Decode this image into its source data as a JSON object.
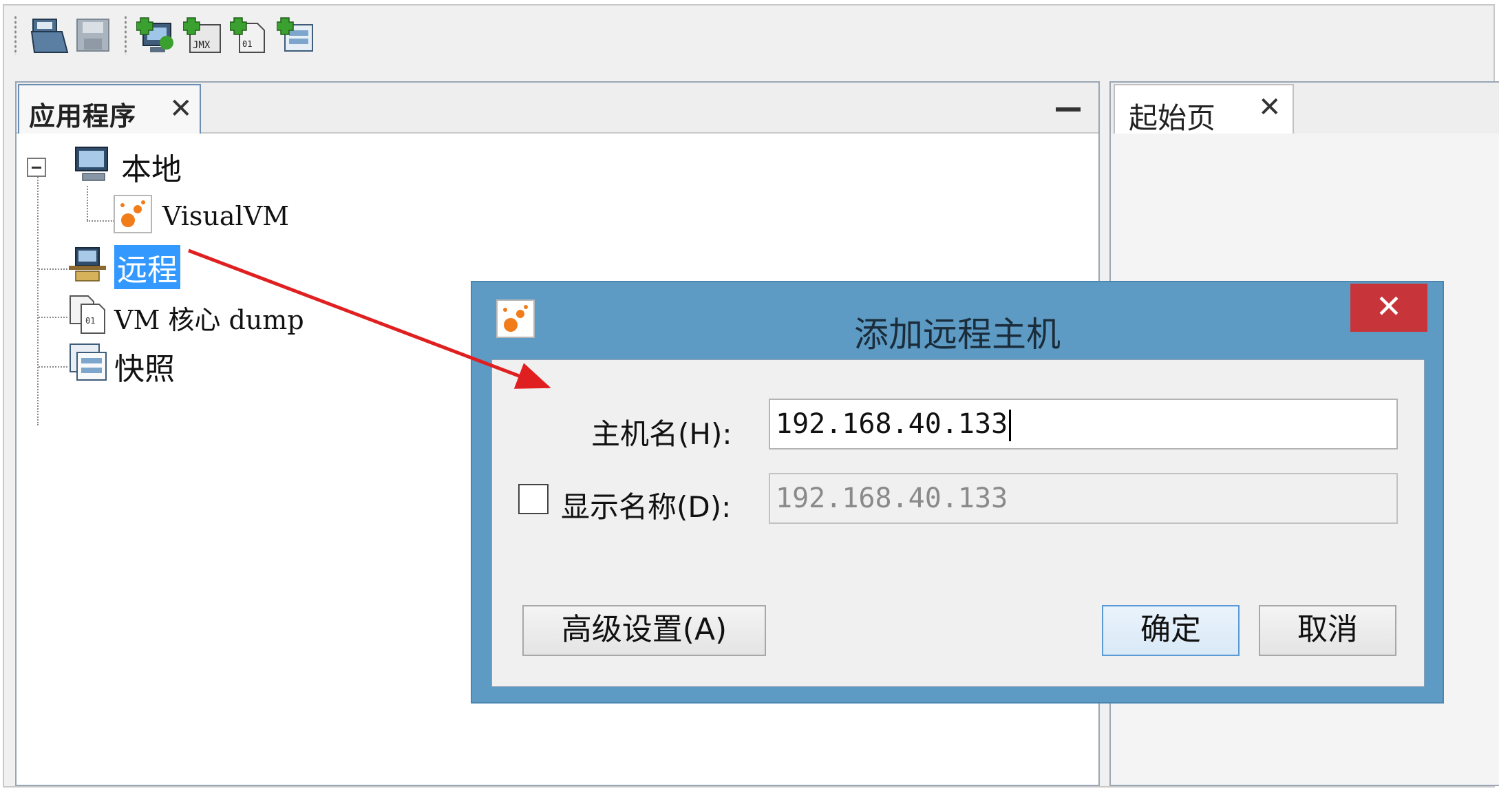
{
  "toolbar": {
    "icons": [
      "open-folder-icon",
      "save-icon",
      "add-host-icon",
      "add-jmx-connection-icon",
      "add-vm-coredump-icon",
      "add-snapshot-icon"
    ]
  },
  "left_panel": {
    "tab_label": "应用程序",
    "tab_close": "✕",
    "tree": {
      "local": "本地",
      "visualvm": "VisualVM",
      "remote": "远程",
      "coredump": "VM 核心 dump",
      "snapshots": "快照",
      "collapse_glyph": "⊟"
    }
  },
  "right_panel": {
    "tab_label": "起始页",
    "tab_close": "✕"
  },
  "dialog": {
    "title": "添加远程主机",
    "close": "✕",
    "hostname_label": "主机名(H):",
    "hostname_value": "192.168.40.133",
    "display_name_label": "显示名称(D):",
    "display_name_value": "192.168.40.133",
    "display_name_checked": false,
    "advanced_button": "高级设置(A)",
    "ok_button": "确定",
    "cancel_button": "取消"
  },
  "colors": {
    "selection": "#3399ff",
    "dialog_frame": "#5d9bc4",
    "close_red": "#c7353a",
    "arrow_red": "#e02020"
  }
}
